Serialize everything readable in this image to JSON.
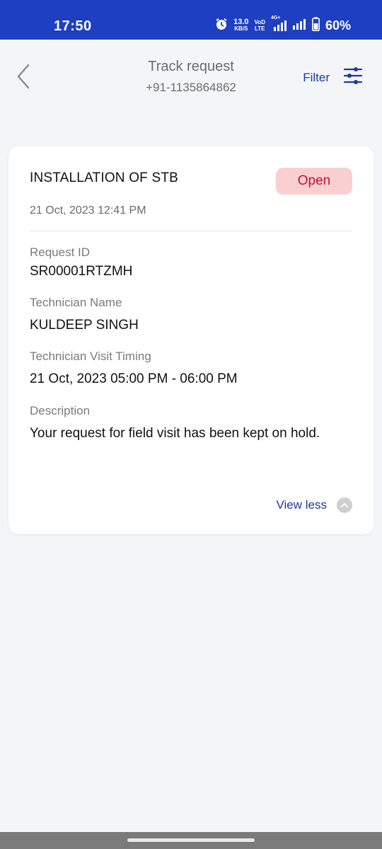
{
  "status_bar": {
    "time": "17:50",
    "speed_value": "13.0",
    "speed_unit": "KB/S",
    "volte_top": "VoD",
    "volte_bottom": "LTE",
    "network": "4G+",
    "battery_percent": "60%"
  },
  "header": {
    "title": "Track request",
    "subtitle": "+91-1135864862",
    "filter_label": "Filter"
  },
  "request": {
    "title": "INSTALLATION OF STB",
    "status": "Open",
    "date": "21 Oct, 2023 12:41 PM",
    "fields": [
      {
        "label": "Request ID",
        "value": "SR00001RTZMH"
      },
      {
        "label": "Technician Name",
        "value": "KULDEEP SINGH"
      },
      {
        "label": "Technician Visit Timing",
        "value": "21 Oct, 2023 05:00 PM - 06:00 PM"
      },
      {
        "label": "Description",
        "value": "Your request for field visit has been kept on hold."
      }
    ],
    "view_less_label": "View less"
  },
  "colors": {
    "status_bar": "#1e3fc2",
    "accent": "#1b3aa6",
    "badge_bg": "#f9cfd2",
    "badge_text": "#c8102e"
  }
}
